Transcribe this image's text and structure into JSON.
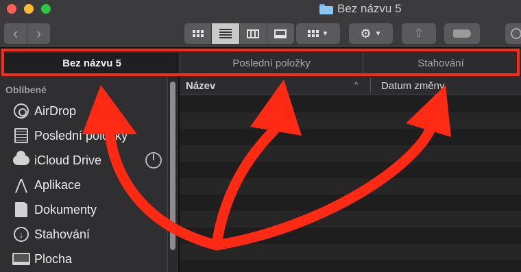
{
  "window": {
    "title": "Bez názvu 5",
    "traffic_colors": [
      "#ff5f57",
      "#febc2e",
      "#28c840"
    ]
  },
  "toolbar": {
    "back_icon": "chevron-left-icon",
    "forward_icon": "chevron-right-icon",
    "view_modes": [
      "icon-view",
      "list-view",
      "column-view",
      "gallery-view"
    ],
    "active_view": "list-view",
    "group_icon": "group-by-icon",
    "action_icon": "gear-icon",
    "share_icon": "share-icon",
    "tag_icon": "tag-icon",
    "search_icon": "search-icon"
  },
  "tabs": [
    {
      "label": "Bez názvu 5",
      "active": true
    },
    {
      "label": "Poslední položky",
      "active": false
    },
    {
      "label": "Stahování",
      "active": false
    }
  ],
  "sidebar": {
    "heading": "Oblíbené",
    "items": [
      {
        "label": "AirDrop",
        "icon": "airdrop-icon"
      },
      {
        "label": "Poslední položky",
        "icon": "recents-icon"
      },
      {
        "label": "iCloud Drive",
        "icon": "cloud-icon"
      },
      {
        "label": "Aplikace",
        "icon": "applications-icon"
      },
      {
        "label": "Dokumenty",
        "icon": "documents-icon"
      },
      {
        "label": "Stahování",
        "icon": "downloads-icon"
      },
      {
        "label": "Plocha",
        "icon": "desktop-icon"
      }
    ]
  },
  "file_list": {
    "columns": [
      "Název",
      "Datum změny"
    ],
    "sort_indicator": "^"
  },
  "annotation": {
    "color": "#ff2a14"
  }
}
